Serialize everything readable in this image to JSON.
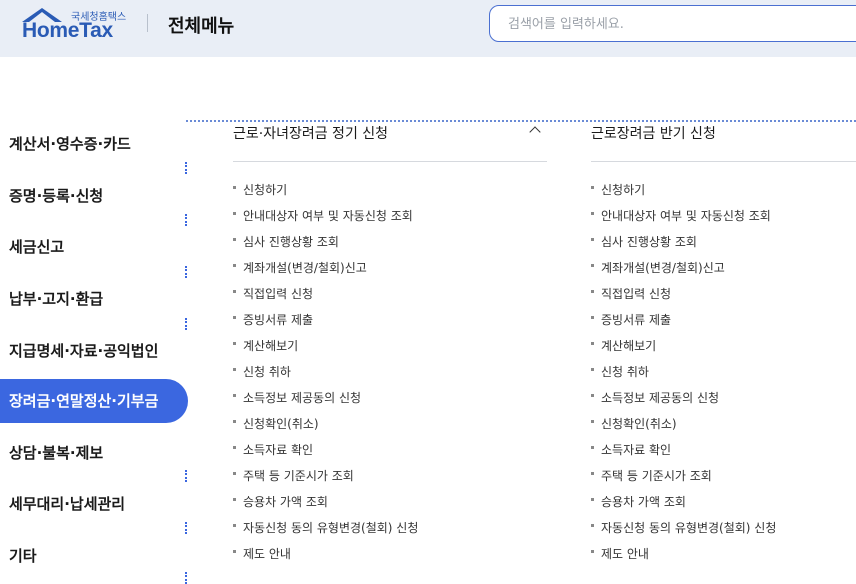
{
  "header": {
    "logo_ko": "국세청홈택스",
    "logo_en": "HomeTax",
    "menu_title": "전체메뉴",
    "search_placeholder": "검색어를 입력하세요."
  },
  "sidebar": {
    "items": [
      {
        "label": "계산서·영수증·카드"
      },
      {
        "label": "증명·등록·신청"
      },
      {
        "label": "세금신고"
      },
      {
        "label": "납부·고지·환급"
      },
      {
        "label": "지급명세·자료·공익법인"
      },
      {
        "label": "장려금·연말정산·기부금",
        "active": true
      },
      {
        "label": "상담·불복·제보"
      },
      {
        "label": "세무대리·납세관리"
      },
      {
        "label": "기타"
      }
    ]
  },
  "columns": [
    {
      "title": "근로·자녀장려금 정기 신청",
      "items": [
        "신청하기",
        "안내대상자 여부 및 자동신청 조회",
        "심사 진행상황 조회",
        "계좌개설(변경/철회)신고",
        "직접입력 신청",
        "증빙서류 제출",
        "계산해보기",
        "신청 취하",
        "소득정보 제공동의 신청",
        "신청확인(취소)",
        "소득자료 확인",
        "주택 등 기준시가 조회",
        "승용차 가액 조회",
        "자동신청 동의 유형변경(철회) 신청",
        "제도 안내"
      ]
    },
    {
      "title": "근로장려금 반기 신청",
      "items": [
        "신청하기",
        "안내대상자 여부 및 자동신청 조회",
        "심사 진행상황 조회",
        "계좌개설(변경/철회)신고",
        "직접입력 신청",
        "증빙서류 제출",
        "계산해보기",
        "신청 취하",
        "소득정보 제공동의 신청",
        "신청확인(취소)",
        "소득자료 확인",
        "주택 등 기준시가 조회",
        "승용차 가액 조회",
        "자동신청 동의 유형변경(철회) 신청",
        "제도 안내"
      ]
    }
  ],
  "colors": {
    "accent": "#3b67e0",
    "header_bg": "#e9eef6",
    "brand": "#2a5bb5"
  }
}
